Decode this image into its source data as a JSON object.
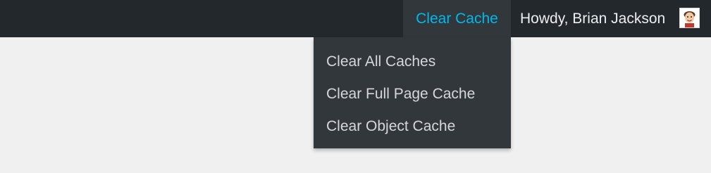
{
  "admin_bar": {
    "clear_cache_label": "Clear Cache",
    "howdy_label": "Howdy, Brian Jackson",
    "avatar_icon": "user-avatar-icon"
  },
  "dropdown": {
    "items": [
      {
        "label": "Clear All Caches"
      },
      {
        "label": "Clear Full Page Cache"
      },
      {
        "label": "Clear Object Cache"
      }
    ]
  },
  "colors": {
    "bar_background": "#23282d",
    "menu_background": "#32373c",
    "accent": "#00b9eb",
    "page_background": "#f1f0f1",
    "menu_text": "#d5d8da"
  }
}
